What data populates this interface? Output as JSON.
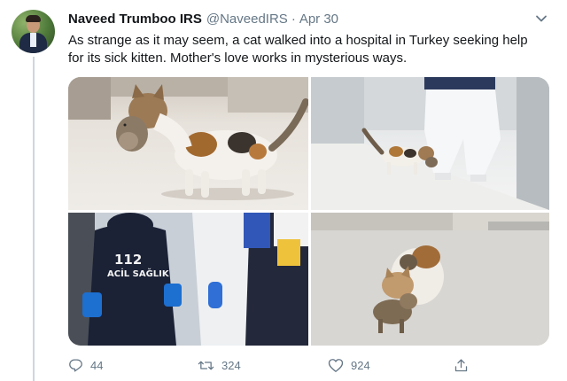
{
  "tweet": {
    "author_name": "Naveed Trumboo IRS",
    "handle": "@NaveedIRS",
    "separator": "·",
    "date": "Apr 30",
    "text": "As strange as it may seem, a cat walked into a hospital in Turkey seeking help for its sick kitten. Mother's love works in mysterious ways.",
    "photo_text": {
      "badge_number": "112",
      "badge_label": "ACİL SAĞLIK"
    },
    "actions": {
      "replies": "44",
      "retweets": "324",
      "likes": "924"
    }
  },
  "icons": {
    "reply": "reply-icon",
    "retweet": "retweet-icon",
    "like": "heart-icon",
    "share": "share-icon",
    "more": "chevron-down-icon"
  },
  "colors": {
    "text": "#14171a",
    "secondary": "#657786",
    "thread_line": "#ccd6dd"
  }
}
